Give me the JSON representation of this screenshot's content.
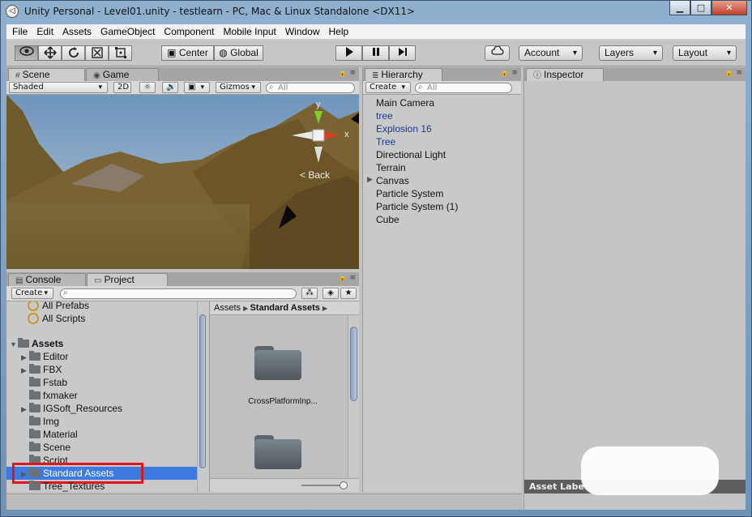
{
  "window": {
    "title": "Unity Personal - Level01.unity - testlearn - PC, Mac & Linux Standalone <DX11>",
    "controls": {
      "minimize": "▁",
      "maximize": "□",
      "close": "✕"
    }
  },
  "menubar": [
    "File",
    "Edit",
    "Assets",
    "GameObject",
    "Component",
    "Mobile Input",
    "Window",
    "Help"
  ],
  "toolbar": {
    "tools": [
      "eye-icon",
      "move-icon",
      "rotate-icon",
      "scale-icon",
      "rect-icon"
    ],
    "pivot": "Center",
    "space": "Global",
    "play_icons": [
      "play-icon",
      "pause-icon",
      "step-icon"
    ],
    "account": "Account",
    "layers": "Layers",
    "layout": "Layout"
  },
  "scene": {
    "tabs": {
      "scene": "Scene",
      "game": "Game"
    },
    "shading": "Shaded",
    "mode_2d": "2D",
    "gizmos": "Gizmos",
    "search_placeholder": "All",
    "gizmo_axis_y": "y",
    "gizmo_axis_x": "x",
    "back_label": "Back"
  },
  "hierarchy": {
    "title": "Hierarchy",
    "create": "Create",
    "search_placeholder": "All",
    "items": [
      {
        "label": "Main Camera",
        "prefab": false,
        "expandable": false
      },
      {
        "label": "tree",
        "prefab": true,
        "expandable": false
      },
      {
        "label": "Explosion 16",
        "prefab": true,
        "expandable": false
      },
      {
        "label": "Tree",
        "prefab": true,
        "expandable": false
      },
      {
        "label": "Directional Light",
        "prefab": false,
        "expandable": false
      },
      {
        "label": "Terrain",
        "prefab": false,
        "expandable": false
      },
      {
        "label": "Canvas",
        "prefab": false,
        "expandable": true
      },
      {
        "label": "Particle System",
        "prefab": false,
        "expandable": false
      },
      {
        "label": "Particle System (1)",
        "prefab": false,
        "expandable": false
      },
      {
        "label": "Cube",
        "prefab": false,
        "expandable": false
      }
    ]
  },
  "inspector": {
    "title": "Inspector",
    "footer": "Asset Labe"
  },
  "project": {
    "tabs": {
      "console": "Console",
      "project": "Project"
    },
    "create": "Create",
    "favorites": [
      "All Prefabs",
      "All Scripts"
    ],
    "root": "Assets",
    "folders": [
      {
        "label": "Editor",
        "expandable": true
      },
      {
        "label": "FBX",
        "expandable": true
      },
      {
        "label": "Fstab",
        "expandable": false
      },
      {
        "label": "fxmaker",
        "expandable": false
      },
      {
        "label": "IGSoft_Resources",
        "expandable": true
      },
      {
        "label": "Img",
        "expandable": false
      },
      {
        "label": "Material",
        "expandable": false
      },
      {
        "label": "Scene",
        "expandable": false
      },
      {
        "label": "Script",
        "expandable": false
      },
      {
        "label": "Standard Assets",
        "expandable": true,
        "selected": true
      },
      {
        "label": "Tree_Textures",
        "expandable": false
      }
    ],
    "breadcrumb": {
      "root": "Assets",
      "current": "Standard Assets"
    },
    "grid_items": [
      "CrossPlatformInp..."
    ]
  },
  "colors": {
    "selection": "#3d7be0",
    "highlight_box": "#e0141e",
    "prefab_text": "#1c3b8f"
  }
}
